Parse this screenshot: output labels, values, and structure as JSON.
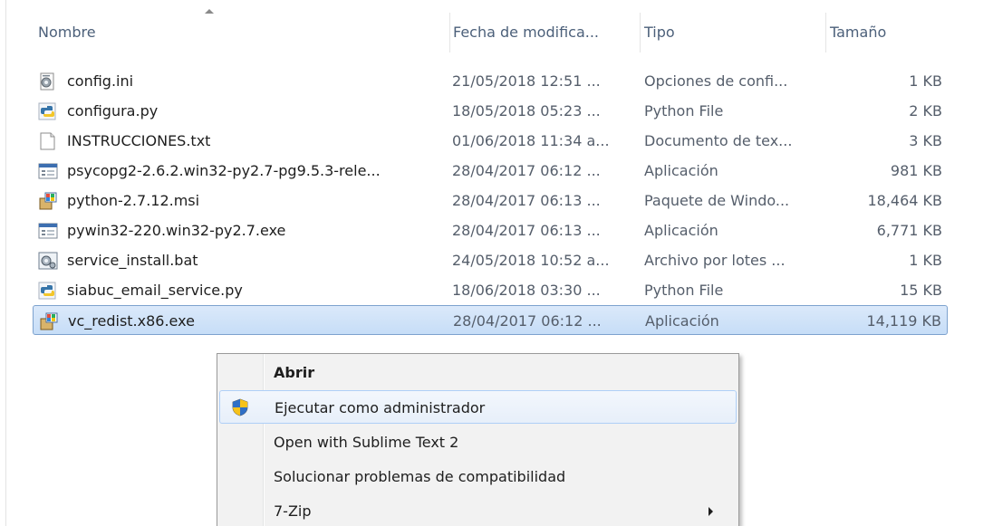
{
  "columns": {
    "name": "Nombre",
    "date": "Fecha de modifica...",
    "type": "Tipo",
    "size": "Tamaño"
  },
  "files": [
    {
      "name": "config.ini",
      "date": "21/05/2018 12:51 ...",
      "type": "Opciones de confi...",
      "size": "1 KB",
      "icon": "settings-file-icon"
    },
    {
      "name": "configura.py",
      "date": "18/05/2018 05:23 ...",
      "type": "Python File",
      "size": "2 KB",
      "icon": "python-file-icon"
    },
    {
      "name": "INSTRUCCIONES.txt",
      "date": "01/06/2018 11:34 a...",
      "type": "Documento de tex...",
      "size": "3 KB",
      "icon": "text-file-icon"
    },
    {
      "name": "psycopg2-2.6.2.win32-py2.7-pg9.5.3-rele...",
      "date": "28/04/2017 06:12 ...",
      "type": "Aplicación",
      "size": "981 KB",
      "icon": "application-icon"
    },
    {
      "name": "python-2.7.12.msi",
      "date": "28/04/2017 06:13 ...",
      "type": "Paquete de Windo...",
      "size": "18,464 KB",
      "icon": "installer-package-icon"
    },
    {
      "name": "pywin32-220.win32-py2.7.exe",
      "date": "28/04/2017 06:13 ...",
      "type": "Aplicación",
      "size": "6,771 KB",
      "icon": "application-icon"
    },
    {
      "name": "service_install.bat",
      "date": "24/05/2018 10:52 a...",
      "type": "Archivo por lotes ...",
      "size": "1 KB",
      "icon": "batch-file-icon"
    },
    {
      "name": "siabuc_email_service.py",
      "date": "18/06/2018 03:30 ...",
      "type": "Python File",
      "size": "15 KB",
      "icon": "python-file-icon"
    },
    {
      "name": "vc_redist.x86.exe",
      "date": "28/04/2017 06:12 ...",
      "type": "Aplicación",
      "size": "14,119 KB",
      "icon": "installer-package-icon"
    }
  ],
  "context_menu": {
    "open": "Abrir",
    "run_as_admin": "Ejecutar como administrador",
    "open_sublime": "Open with Sublime Text 2",
    "troubleshoot": "Solucionar problemas de compatibilidad",
    "seven_zip": "7-Zip"
  },
  "colors": {
    "selection": "#cde4f7",
    "selection_border": "#7da2ce",
    "header_text": "#4c607a",
    "menu_bg": "#f2f2f2"
  }
}
